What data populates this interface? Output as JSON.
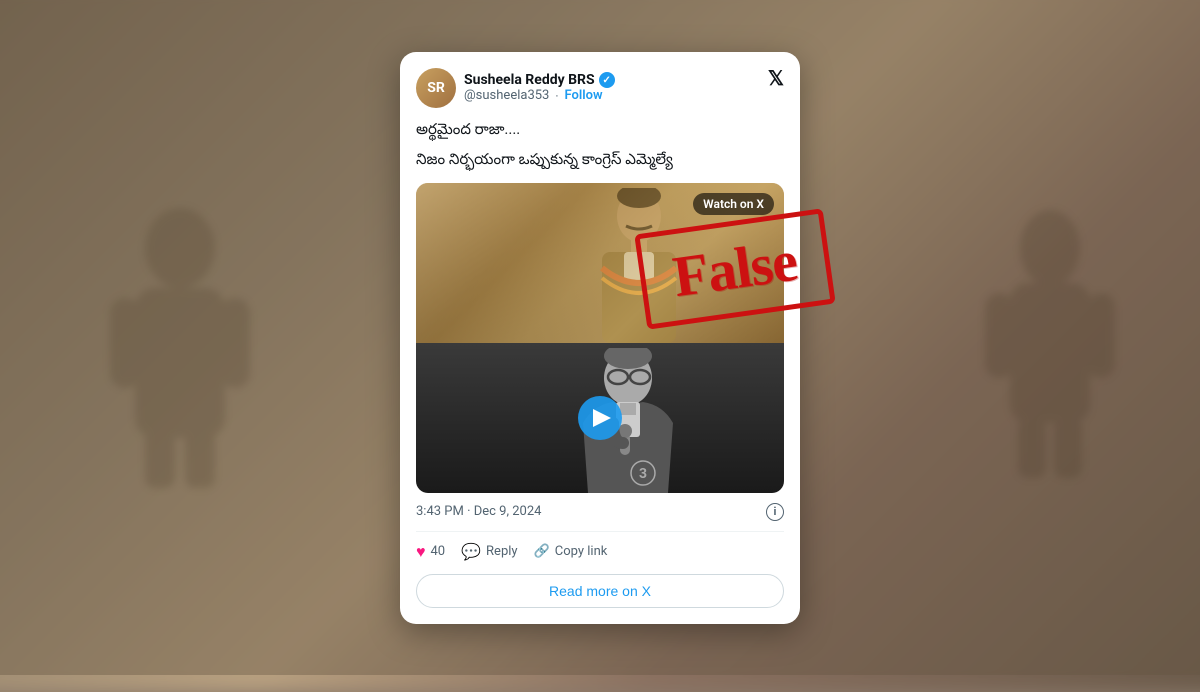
{
  "background": {
    "color": "#8a7a6a"
  },
  "tweet": {
    "user": {
      "name": "Susheela Reddy BRS",
      "handle": "@susheela353",
      "verified": true,
      "follow_label": "Follow"
    },
    "text": {
      "line1": "అర్థమైంద రాజా....",
      "line2": "నిజం నిర్భయంగా ఒప్పుకున్న కాంగ్రెస్ ఎమ్మెల్యే"
    },
    "video": {
      "watch_on_x_label": "Watch on X"
    },
    "timestamp": "3:43 PM · Dec 9, 2024",
    "stats": {
      "likes": "40",
      "reply_label": "Reply",
      "copy_link_label": "Copy link"
    },
    "read_more_label": "Read more on X"
  },
  "stamp": {
    "text": "False"
  },
  "icons": {
    "x_logo": "𝕏",
    "heart": "♥",
    "bubble": "💬",
    "link": "🔗",
    "info": "i",
    "play": "▶"
  }
}
